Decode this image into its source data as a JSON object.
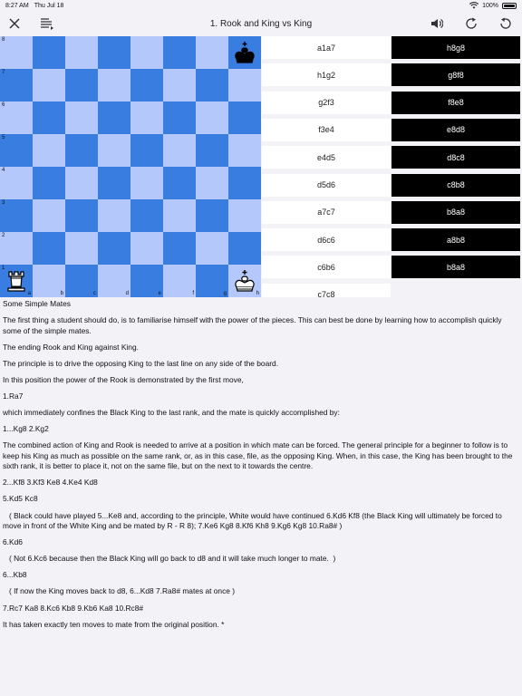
{
  "status": {
    "time": "8:27 AM",
    "date": "Thu Jul 18",
    "battery": "100%"
  },
  "toolbar": {
    "title": "1. Rook and King vs King"
  },
  "board": {
    "ranks": [
      "8",
      "7",
      "6",
      "5",
      "4",
      "3",
      "2",
      "1"
    ],
    "files": [
      "a",
      "b",
      "c",
      "d",
      "e",
      "f",
      "g",
      "h"
    ]
  },
  "moves": [
    {
      "white": "a1a7",
      "black": "h8g8"
    },
    {
      "white": "h1g2",
      "black": "g8f8"
    },
    {
      "white": "g2f3",
      "black": "f8e8"
    },
    {
      "white": "f3e4",
      "black": "e8d8"
    },
    {
      "white": "e4d5",
      "black": "d8c8"
    },
    {
      "white": "d5d6",
      "black": "c8b8"
    },
    {
      "white": "a7c7",
      "black": "b8a8"
    },
    {
      "white": "d6c6",
      "black": "a8b8"
    },
    {
      "white": "c6b6",
      "black": "b8a8"
    },
    {
      "white": "c7c8",
      "black": ""
    }
  ],
  "text": {
    "heading": "Some Simple Mates",
    "paragraphs": [
      "The first thing a student should do, is to familiarise himself with the power of the pieces. This can best be done by learning how to accomplish quickly some of the simple mates.",
      "The ending Rook and King against King.",
      "The principle is to drive the opposing King to the last line on any side of the board.",
      "In this position the power of the Rook is demonstrated by the first move,",
      "1.Ra7",
      "which immediately confines the Black King to the last rank, and the mate is quickly accomplished by:",
      "1...Kg8 2.Kg2",
      "The combined action of King and Rook is needed to arrive at a position in which mate can be forced. The general principle for a beginner to follow is to keep his King as much as possible on the same rank, or, as in this case, file, as the opposing King. When, in this case, the King has been brought to the sixth rank, it is better to place it, not on the same file, but on the next to it towards the centre.",
      "2...Kf8 3.Kf3 Ke8 4.Ke4 Kd8",
      "5.Kd5 Kc8",
      "   ( Black could have played 5...Ke8 and, according to the principle, White would have continued 6.Kd6 Kf8 (the Black King will ultimately be forced to move in front of the White King and be mated by R - R 8); 7.Ke6 Kg8 8.Kf6 Kh8 9.Kg6 Kg8 10.Ra8# )",
      "6.Kd6",
      "   ( Not 6.Kc6 because then the Black King will go back to d8 and it will take much longer to mate.  )",
      "6...Kb8",
      "   ( If now the King moves back to d8, 6...Kd8 7.Ra8# mates at once )",
      "7.Rc7 Ka8 8.Kc6 Kb8 9.Kb6 Ka8 10.Rc8#",
      "It has taken exactly ten moves to mate from the original position. *"
    ]
  }
}
